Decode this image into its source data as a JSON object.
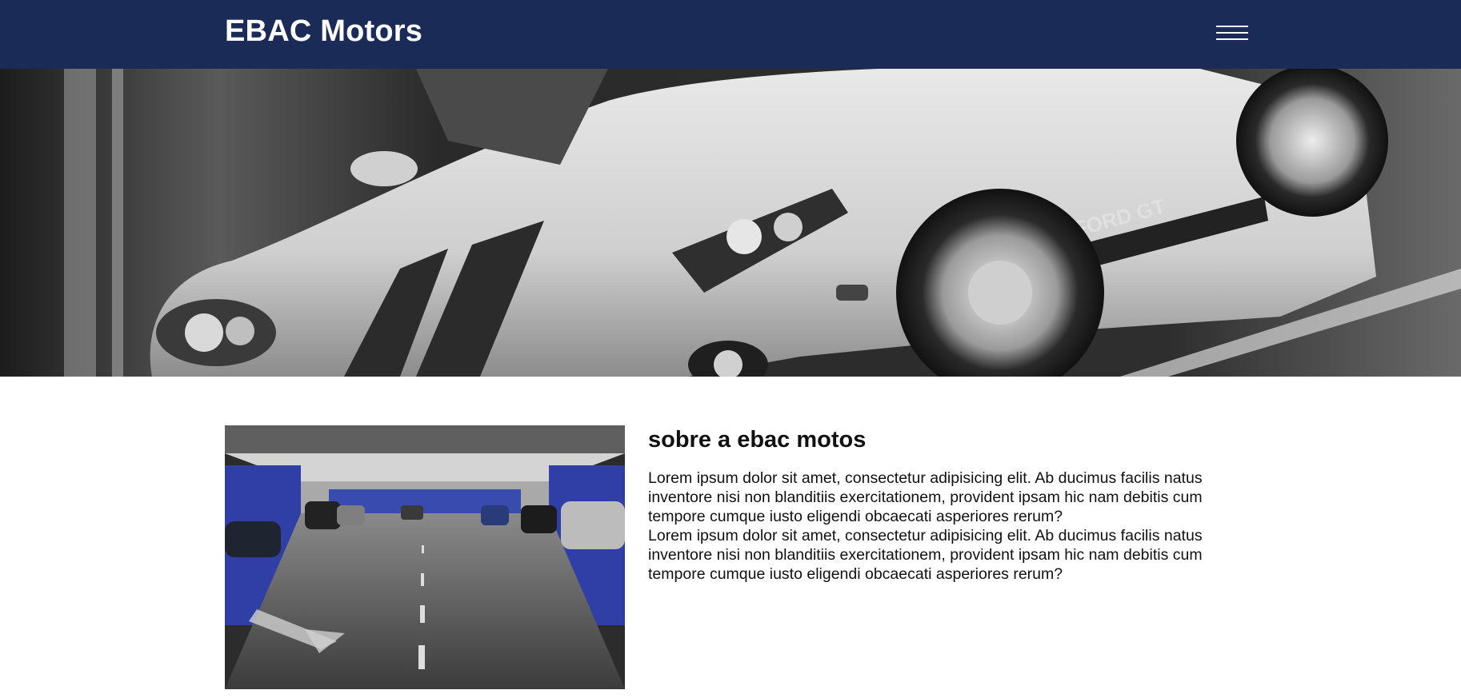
{
  "header": {
    "brand": "EBAC Motors",
    "menu_icon": "hamburger-menu-icon",
    "background_color": "#1a2b57"
  },
  "hero": {
    "image": "black-and-white sports car photo",
    "badge_text": "FORD GT"
  },
  "about": {
    "title": "sobre a ebac motos",
    "paragraphs": [
      "Lorem ipsum dolor sit amet, consectetur adipisicing elit. Ab ducimus facilis natus inventore nisi non blanditiis exercitationem, provident ipsam hic nam debitis cum tempore cumque iusto eligendi obcaecati asperiores rerum?",
      "Lorem ipsum dolor sit amet, consectetur adipisicing elit. Ab ducimus facilis natus inventore nisi non blanditiis exercitationem, provident ipsam hic nam debitis cum tempore cumque iusto eligendi obcaecati asperiores rerum?"
    ],
    "image": "parking garage photo"
  }
}
